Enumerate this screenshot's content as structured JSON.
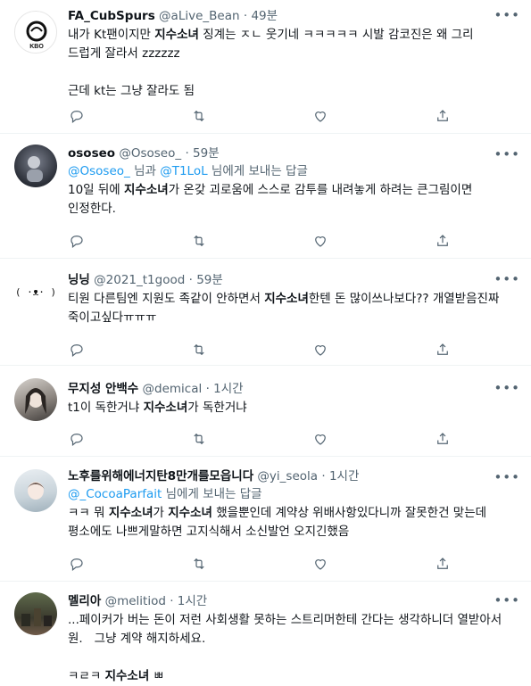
{
  "tweets": [
    {
      "name": "FA_CubSpurs",
      "handle": "@aLive_Bean",
      "time": "49분",
      "avatar_logo": "KBO",
      "parts": [
        {
          "t": "내가 Kt팬이지만 "
        },
        {
          "t": "지수소녀",
          "b": true
        },
        {
          "t": " 징계는 ㅈㄴ 웃기네 ㅋㅋㅋㅋㅋ 시발 감코진은 왜 그리 드럽게 잘라서 zzzzzz\n\n근데 kt는 그냥 잘라도 됨"
        }
      ]
    },
    {
      "name": "ososeo",
      "handle": "@Ososeo_",
      "time": "59분",
      "reply": {
        "mention1": "@Ososeo_",
        "and": "님과",
        "mention2": "@T1LoL",
        "suffix": "님에게 보내는 답글"
      },
      "parts": [
        {
          "t": "10일 뒤에 "
        },
        {
          "t": "지수소녀",
          "b": true
        },
        {
          "t": "가 온갖 괴로움에 스스로 감투를 내려놓게 하려는 큰그림이면 인정한다."
        }
      ]
    },
    {
      "name": "닝닝",
      "handle": "@2021_t1good",
      "time": "59분",
      "avatar_logo": "( ·ᴥ· )",
      "parts": [
        {
          "t": "티원 다른팀엔 지원도 족같이 안하면서 "
        },
        {
          "t": "지수소녀",
          "b": true
        },
        {
          "t": "한텐 돈 많이쓰나보다?? 개열받음진짜 죽이고싶다ㅠㅠㅠ"
        }
      ]
    },
    {
      "name": "무지성 안백수",
      "handle": "@demical",
      "time": "1시간",
      "parts": [
        {
          "t": "t1이 독한거냐 "
        },
        {
          "t": "지수소녀",
          "b": true
        },
        {
          "t": "가 독한거냐"
        }
      ]
    },
    {
      "name": "노후를위해에너지탄8만개를모읍니다",
      "handle": "@yi_seola",
      "time": "1시간",
      "reply": {
        "mention1": "@_CocoaParfait",
        "suffix": "님에게 보내는 답글"
      },
      "parts": [
        {
          "t": "ㅋㅋ 뭐 "
        },
        {
          "t": "지수소녀",
          "b": true
        },
        {
          "t": "가 "
        },
        {
          "t": "지수소녀",
          "b": true
        },
        {
          "t": " 했을뿐인데 계약상 위배사항있다니까 잘못한건 맞는데 평소에도 나쁘게말하면 고지식해서 소신발언 오지긴했음"
        }
      ]
    },
    {
      "name": "멜리아",
      "handle": "@melitiod",
      "time": "1시간",
      "parts": [
        {
          "t": "...페이커가 버는 돈이 저런 사회생활 못하는 스트리머한테 간다는 생각하니더 열받아서 원.   그냥 계약 해지하세요.\n\n"
        },
        {
          "t": "ㅋㄹㅋ "
        },
        {
          "t": "지수소녀",
          "b": true
        },
        {
          "t": " ㅃ"
        }
      ]
    }
  ],
  "icons": {
    "more": "more-icon",
    "reply": "reply-icon",
    "retweet": "retweet-icon",
    "like": "like-icon",
    "share": "share-icon"
  },
  "colors": {
    "text": "#0f1419",
    "muted": "#536471",
    "link": "#1d9bf0",
    "divider": "#eff3f4"
  }
}
